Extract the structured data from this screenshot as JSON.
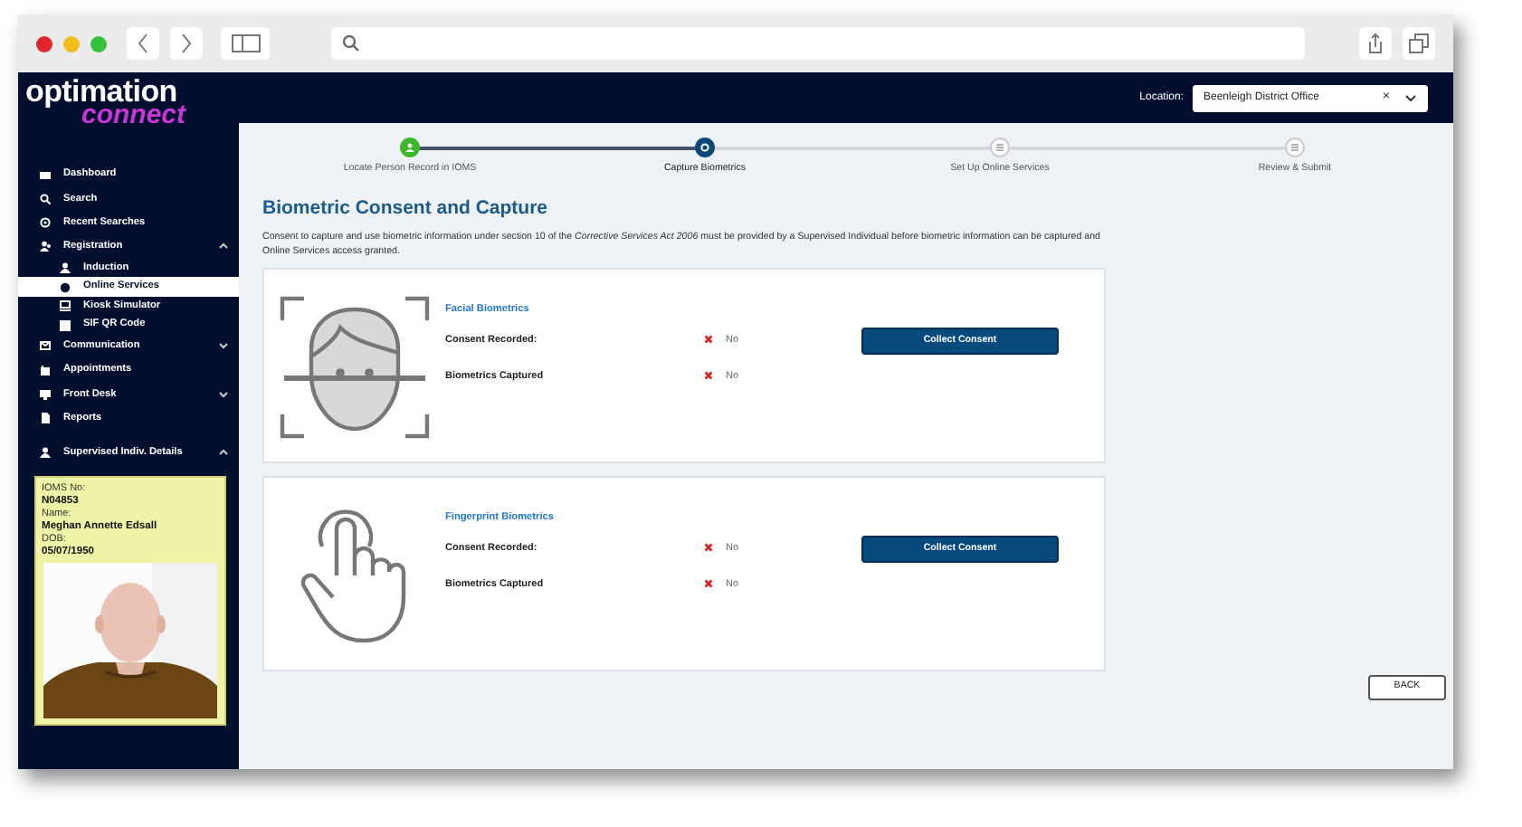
{
  "logo": {
    "line1": "optimation",
    "line2": "connect"
  },
  "location": {
    "label": "Location:",
    "value": "Beenleigh District Office",
    "clear": "×"
  },
  "sidebar": {
    "items": [
      {
        "label": "Dashboard"
      },
      {
        "label": "Search"
      },
      {
        "label": "Recent Searches"
      },
      {
        "label": "Registration",
        "expanded": true,
        "children": [
          {
            "label": "Induction",
            "selected": false
          },
          {
            "label": "Online Services",
            "selected": true
          },
          {
            "label": "Kiosk Simulator",
            "selected": false
          },
          {
            "label": "SIF QR Code",
            "selected": false
          }
        ]
      },
      {
        "label": "Communication",
        "expanded": false
      },
      {
        "label": "Appointments"
      },
      {
        "label": "Front Desk",
        "expanded": false
      },
      {
        "label": "Reports"
      },
      {
        "label": "Supervised Indiv. Details",
        "expanded": true
      }
    ]
  },
  "details": {
    "fields": [
      {
        "label": "IOMS No:",
        "value": "N04853"
      },
      {
        "label": "Name:",
        "value": "Meghan Annette Edsall"
      },
      {
        "label": "DOB:",
        "value": "05/07/1950"
      }
    ]
  },
  "steps": [
    {
      "label": "Locate Person Record in IOMS",
      "completed": true,
      "selected": false
    },
    {
      "label": "Capture Biometrics",
      "completed": false,
      "selected": true
    },
    {
      "label": "Set Up Online Services",
      "completed": false,
      "selected": false
    },
    {
      "label": "Review & Submit",
      "completed": false,
      "selected": false
    }
  ],
  "heading": "Biometric Consent and Capture",
  "intro": "Consent to capture and use biometric information under section 10 of the *Corrective Services Act 2006* must be provided by a Supervised Individual before biometric information can be captured and Online Services access granted.",
  "cards": [
    {
      "kind": "face",
      "title": "Facial Biometrics",
      "rows": [
        {
          "label": "Consent Recorded:",
          "status": "No",
          "ok": false
        },
        {
          "label": "Biometrics Captured",
          "status": "No",
          "ok": false
        }
      ],
      "button": "Collect Consent"
    },
    {
      "kind": "fingerprint",
      "title": "Fingerprint Biometrics",
      "rows": [
        {
          "label": "Consent Recorded:",
          "status": "No",
          "ok": false
        },
        {
          "label": "Biometrics Captured",
          "status": "No",
          "ok": false
        }
      ],
      "button": "Collect Consent"
    }
  ],
  "back_button": "BACK"
}
